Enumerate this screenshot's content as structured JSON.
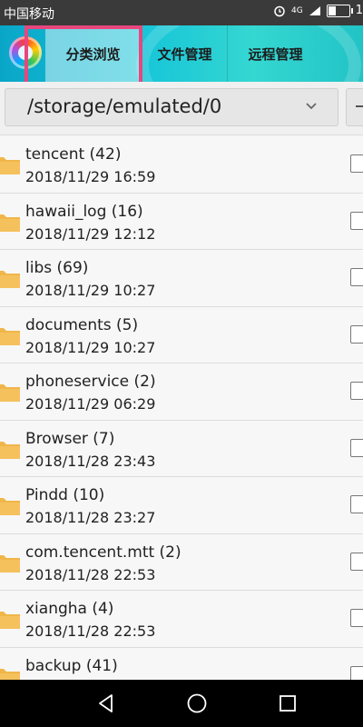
{
  "status_bar": {
    "carrier": "中国移动",
    "network": "4G",
    "time_partial": "1"
  },
  "header": {
    "tabs": [
      {
        "label": "分类浏览",
        "active": true
      },
      {
        "label": "文件管理",
        "active": false
      },
      {
        "label": "远程管理",
        "active": false
      }
    ]
  },
  "path_bar": {
    "path": "/storage/emulated/0"
  },
  "files": [
    {
      "name": "tencent (42)",
      "date": "2018/11/29 16:59"
    },
    {
      "name": "hawaii_log (16)",
      "date": "2018/11/29 12:12"
    },
    {
      "name": "libs (69)",
      "date": "2018/11/29 10:27"
    },
    {
      "name": "documents (5)",
      "date": "2018/11/29 10:27"
    },
    {
      "name": "phoneservice (2)",
      "date": "2018/11/29 06:29"
    },
    {
      "name": "Browser (7)",
      "date": "2018/11/28 23:43"
    },
    {
      "name": "Pindd (10)",
      "date": "2018/11/28 23:27"
    },
    {
      "name": "com.tencent.mtt (2)",
      "date": "2018/11/28 22:53"
    },
    {
      "name": "xiangha (4)",
      "date": "2018/11/28 22:53"
    },
    {
      "name": "backup (41)",
      "date": ""
    }
  ],
  "colors": {
    "highlight": "#e8467c",
    "folder": "#f0b64a",
    "header_accent": "#17c6d8"
  },
  "icons": {
    "nav": [
      "back-icon",
      "home-icon",
      "recents-icon"
    ]
  }
}
